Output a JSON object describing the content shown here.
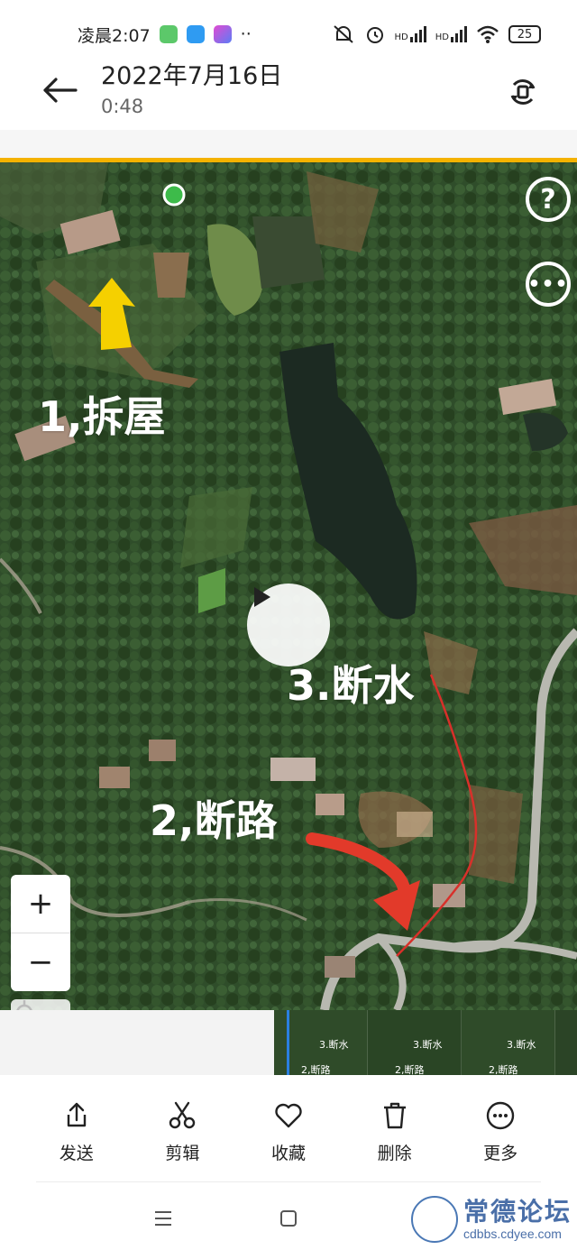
{
  "status_bar": {
    "time": "凌晨2:07",
    "more": "··",
    "network_1": "HD",
    "network_2": "HD",
    "battery": "25"
  },
  "header": {
    "title": "2022年7月16日",
    "subtitle": "0:48"
  },
  "map": {
    "annotations": {
      "label_1": "1,拆屋",
      "label_2": "2,断路",
      "label_3": "3.断水"
    },
    "zoom_in": "+",
    "zoom_out": "−",
    "colors": {
      "forest": "#2d4a28",
      "pond": "#1c2a22",
      "road": "#b8b8b0",
      "arrow_yellow": "#f5d000",
      "arrow_red": "#e23a2a",
      "marker_green": "#3dbb4a"
    }
  },
  "timeline": {
    "frames": [
      {
        "top": "3.断水",
        "bottom": "2,断路"
      },
      {
        "top": "3.断水",
        "bottom": "2,断路"
      },
      {
        "top": "3.断水",
        "bottom": "2,断路"
      }
    ]
  },
  "actions": [
    {
      "label": "发送",
      "icon": "share-icon"
    },
    {
      "label": "剪辑",
      "icon": "scissors-icon"
    },
    {
      "label": "收藏",
      "icon": "heart-icon"
    },
    {
      "label": "删除",
      "icon": "trash-icon"
    },
    {
      "label": "更多",
      "icon": "more-icon"
    }
  ],
  "watermark": {
    "title": "常德论坛",
    "url": "cdbbs.cdyee.com"
  },
  "accent_color": "#f4b200"
}
